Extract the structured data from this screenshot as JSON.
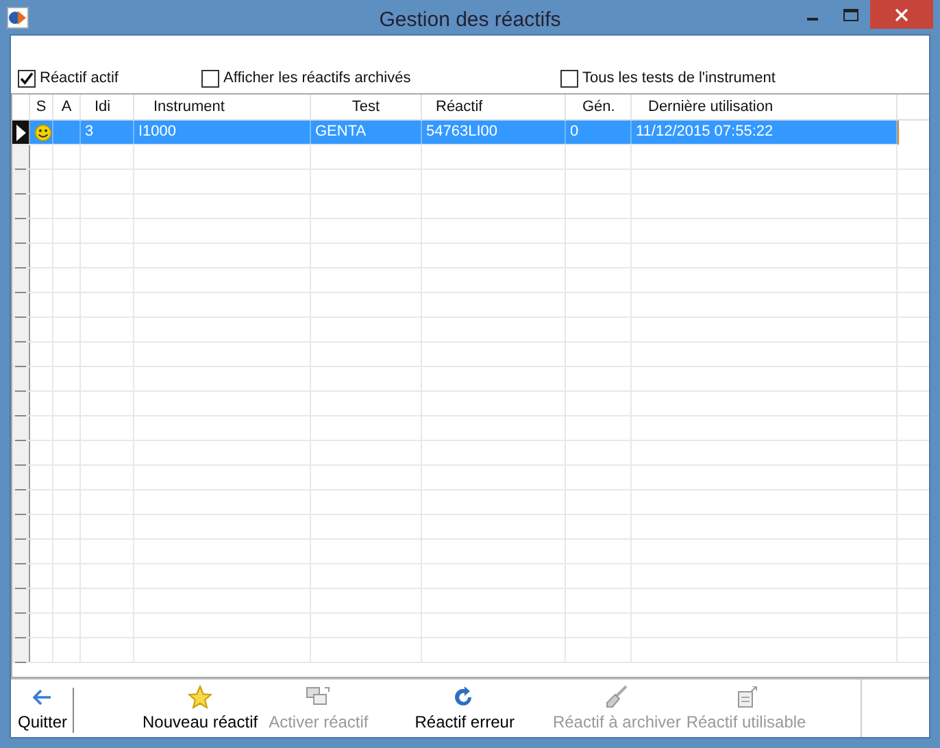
{
  "window": {
    "title": "Gestion des réactifs"
  },
  "options": [
    {
      "label": "Réactif actif",
      "checked": true
    },
    {
      "label": "Afficher les réactifs archivés",
      "checked": false
    },
    {
      "label": "Tous les tests de l'instrument",
      "checked": false
    }
  ],
  "table": {
    "columns": [
      "S",
      "A",
      "Idi",
      "Instrument",
      "Test",
      "Réactif",
      "Gén.",
      "Dernière utilisation"
    ],
    "rows": [
      {
        "selected": true,
        "cells": [
          "",
          "",
          "3",
          "I1000",
          "GENTA",
          "54763LI00",
          "0",
          "11/12/2015 07:55:22"
        ]
      }
    ]
  },
  "toolbar": [
    {
      "label": "Quitter",
      "kind": "back",
      "disabled": false
    },
    {
      "label": "Nouveau réactif",
      "kind": "star",
      "disabled": false
    },
    {
      "label": "Activer réactif",
      "kind": "windows",
      "disabled": true
    },
    {
      "label": "Réactif erreur",
      "kind": "refresh",
      "disabled": false
    },
    {
      "label": "Réactif à archiver",
      "kind": "brush",
      "disabled": true
    },
    {
      "label": "Réactif utilisable",
      "kind": "doc",
      "disabled": true
    }
  ]
}
